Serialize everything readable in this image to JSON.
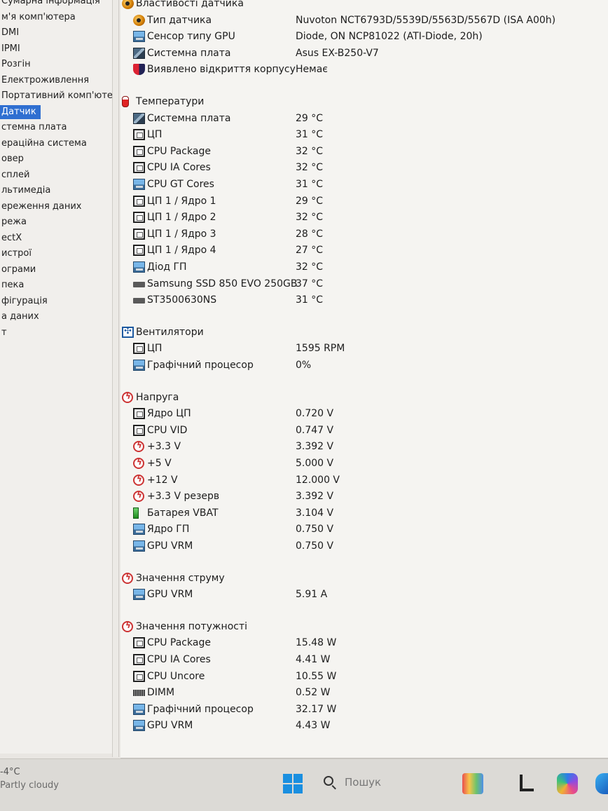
{
  "sidebar": {
    "items": [
      {
        "label": "Сумарна інформація",
        "selected": false
      },
      {
        "label": "м'я комп'ютера",
        "selected": false
      },
      {
        "label": "DMI",
        "selected": false
      },
      {
        "label": "IPMI",
        "selected": false
      },
      {
        "label": "Розгін",
        "selected": false
      },
      {
        "label": "Електроживлення",
        "selected": false
      },
      {
        "label": "Портативний комп'юте",
        "selected": false
      },
      {
        "label": "Датчик",
        "selected": true
      },
      {
        "label": "стемна плата",
        "selected": false
      },
      {
        "label": "ераційна система",
        "selected": false
      },
      {
        "label": "овер",
        "selected": false
      },
      {
        "label": "сплей",
        "selected": false
      },
      {
        "label": "льтимедіа",
        "selected": false
      },
      {
        "label": "ереження даних",
        "selected": false
      },
      {
        "label": "режа",
        "selected": false
      },
      {
        "label": "ectX",
        "selected": false
      },
      {
        "label": "истрої",
        "selected": false
      },
      {
        "label": "ограми",
        "selected": false
      },
      {
        "label": "пека",
        "selected": false
      },
      {
        "label": "фігурація",
        "selected": false
      },
      {
        "label": "а даних",
        "selected": false
      },
      {
        "label": "т",
        "selected": false
      }
    ]
  },
  "sensor_panel": {
    "rows": [
      {
        "kind": "header",
        "icon": "sensor-icon",
        "name": "Властивості датчика",
        "value": ""
      },
      {
        "kind": "item",
        "icon": "sensor-icon",
        "name": "Тип датчика",
        "value": "Nuvoton NCT6793D/5539D/5563D/5567D  (ISA A00h)"
      },
      {
        "kind": "item",
        "icon": "gpu-icon",
        "name": "Сенсор типу GPU",
        "value": "Diode, ON NCP81022  (ATI-Diode, 20h)"
      },
      {
        "kind": "item",
        "icon": "motherboard-icon",
        "name": "Системна плата",
        "value": "Asus EX-B250-V7"
      },
      {
        "kind": "item",
        "icon": "shield-icon",
        "name": "Виявлено відкриття корпусу",
        "value": "Немає"
      },
      {
        "kind": "gap"
      },
      {
        "kind": "header",
        "icon": "thermometer-icon",
        "name": "Температури",
        "value": ""
      },
      {
        "kind": "item",
        "icon": "motherboard-icon",
        "name": "Системна плата",
        "value": "29 °C"
      },
      {
        "kind": "item",
        "icon": "cpu-icon",
        "name": "ЦП",
        "value": "31 °C"
      },
      {
        "kind": "item",
        "icon": "cpu-icon",
        "name": "CPU Package",
        "value": "32 °C"
      },
      {
        "kind": "item",
        "icon": "cpu-icon",
        "name": "CPU IA Cores",
        "value": "32 °C"
      },
      {
        "kind": "item",
        "icon": "gpu-icon",
        "name": "CPU GT Cores",
        "value": "31 °C"
      },
      {
        "kind": "item",
        "icon": "cpu-icon",
        "name": "ЦП 1 / Ядро 1",
        "value": "29 °C"
      },
      {
        "kind": "item",
        "icon": "cpu-icon",
        "name": "ЦП 1 / Ядро 2",
        "value": "32 °C"
      },
      {
        "kind": "item",
        "icon": "cpu-icon",
        "name": "ЦП 1 / Ядро 3",
        "value": "28 °C"
      },
      {
        "kind": "item",
        "icon": "cpu-icon",
        "name": "ЦП 1 / Ядро 4",
        "value": "27 °C"
      },
      {
        "kind": "item",
        "icon": "gpu-icon",
        "name": "Діод ГП",
        "value": "32 °C"
      },
      {
        "kind": "item",
        "icon": "disk-icon",
        "name": "Samsung SSD 850 EVO 250GB",
        "value": "37 °C"
      },
      {
        "kind": "item",
        "icon": "disk-icon",
        "name": "ST3500630NS",
        "value": "31 °C"
      },
      {
        "kind": "gap"
      },
      {
        "kind": "header",
        "icon": "fan-icon",
        "name": "Вентилятори",
        "value": ""
      },
      {
        "kind": "item",
        "icon": "cpu-icon",
        "name": "ЦП",
        "value": "1595 RPM"
      },
      {
        "kind": "item",
        "icon": "gpu-icon",
        "name": "Графічний процесор",
        "value": "0%"
      },
      {
        "kind": "gap"
      },
      {
        "kind": "header",
        "icon": "voltage-icon",
        "name": "Напруга",
        "value": ""
      },
      {
        "kind": "item",
        "icon": "cpu-icon",
        "name": "Ядро ЦП",
        "value": "0.720 V"
      },
      {
        "kind": "item",
        "icon": "cpu-icon",
        "name": "CPU VID",
        "value": "0.747 V"
      },
      {
        "kind": "item",
        "icon": "voltage-icon",
        "name": "+3.3 V",
        "value": "3.392 V"
      },
      {
        "kind": "item",
        "icon": "voltage-icon",
        "name": "+5 V",
        "value": "5.000 V"
      },
      {
        "kind": "item",
        "icon": "voltage-icon",
        "name": "+12 V",
        "value": "12.000 V"
      },
      {
        "kind": "item",
        "icon": "voltage-icon",
        "name": "+3.3 V резерв",
        "value": "3.392 V"
      },
      {
        "kind": "item",
        "icon": "battery-icon",
        "name": "Батарея VBAT",
        "value": "3.104 V"
      },
      {
        "kind": "item",
        "icon": "gpu-icon",
        "name": "Ядро ГП",
        "value": "0.750 V"
      },
      {
        "kind": "item",
        "icon": "gpu-icon",
        "name": "GPU VRM",
        "value": "0.750 V"
      },
      {
        "kind": "gap"
      },
      {
        "kind": "header",
        "icon": "voltage-icon",
        "name": "Значення струму",
        "value": ""
      },
      {
        "kind": "item",
        "icon": "gpu-icon",
        "name": "GPU VRM",
        "value": "5.91 A"
      },
      {
        "kind": "gap"
      },
      {
        "kind": "header",
        "icon": "voltage-icon",
        "name": "Значення потужності",
        "value": ""
      },
      {
        "kind": "item",
        "icon": "cpu-icon",
        "name": "CPU Package",
        "value": "15.48 W"
      },
      {
        "kind": "item",
        "icon": "cpu-icon",
        "name": "CPU IA Cores",
        "value": "4.41 W"
      },
      {
        "kind": "item",
        "icon": "cpu-icon",
        "name": "CPU Uncore",
        "value": "10.55 W"
      },
      {
        "kind": "item",
        "icon": "ram-icon",
        "name": "DIMM",
        "value": "0.52 W"
      },
      {
        "kind": "item",
        "icon": "gpu-icon",
        "name": "Графічний процесор",
        "value": "32.17 W"
      },
      {
        "kind": "item",
        "icon": "gpu-icon",
        "name": "GPU VRM",
        "value": "4.43 W"
      }
    ]
  },
  "taskbar": {
    "weather_temp": "-4°C",
    "weather_text": "Partly cloudy",
    "search_placeholder": "Пошук",
    "icons": {
      "start": "windows-start-icon",
      "search": "search-icon",
      "apps": [
        "gallery-icon",
        "widgets-icon",
        "copilot-icon",
        "edge-icon"
      ]
    }
  },
  "colors": {
    "selection": "#2f6fd1",
    "panel_bg": "#f5f4f1",
    "taskbar_bg": "#dcdad6"
  }
}
